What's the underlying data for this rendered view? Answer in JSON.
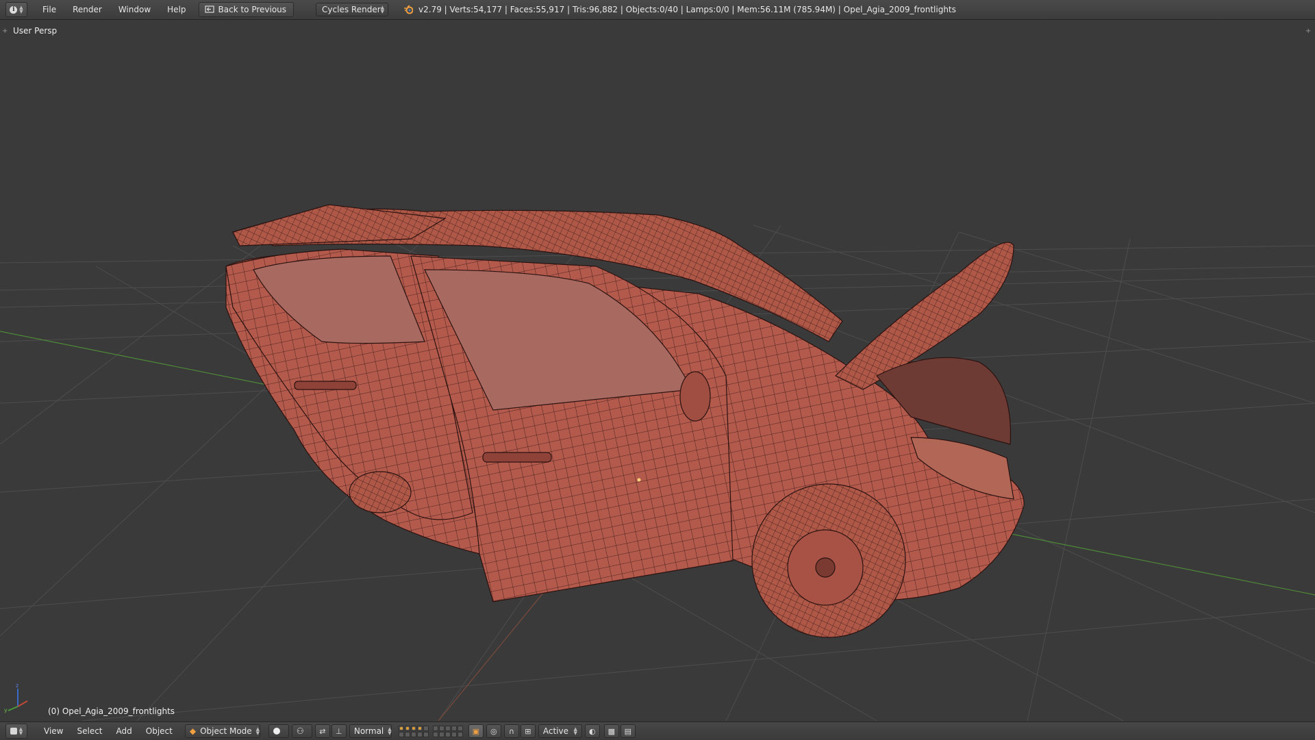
{
  "info_header": {
    "editor_type_icon": "info-icon",
    "menus": [
      "File",
      "Render",
      "Window",
      "Help"
    ],
    "back_button_label": "Back to Previous",
    "render_engine": "Cycles Render",
    "stats": "v2.79 | Verts:54,177 | Faces:55,917 | Tris:96,882 | Objects:0/40 | Lamps:0/0 | Mem:56.11M (785.94M) | Opel_Agia_2009_frontlights"
  },
  "viewport": {
    "view_label": "User Persp",
    "object_label": "(0) Opel_Agia_2009_frontlights",
    "mesh_color": "#b45a4c",
    "wire_color": "#2a1210",
    "grid_color": "#555555",
    "x_axis_color": "#5a9a3c",
    "y_axis_color": "#8a4a3c"
  },
  "view3d_header": {
    "editor_type_icon": "3d-view-icon",
    "menus": [
      "View",
      "Select",
      "Add",
      "Object"
    ],
    "mode": "Object Mode",
    "transform_orientation": "Normal",
    "pivot_icon": "pivot-point-icon",
    "manipulator_icon": "manipulator-icon",
    "snap_target": "Active",
    "accent_color": "#e0a030"
  }
}
